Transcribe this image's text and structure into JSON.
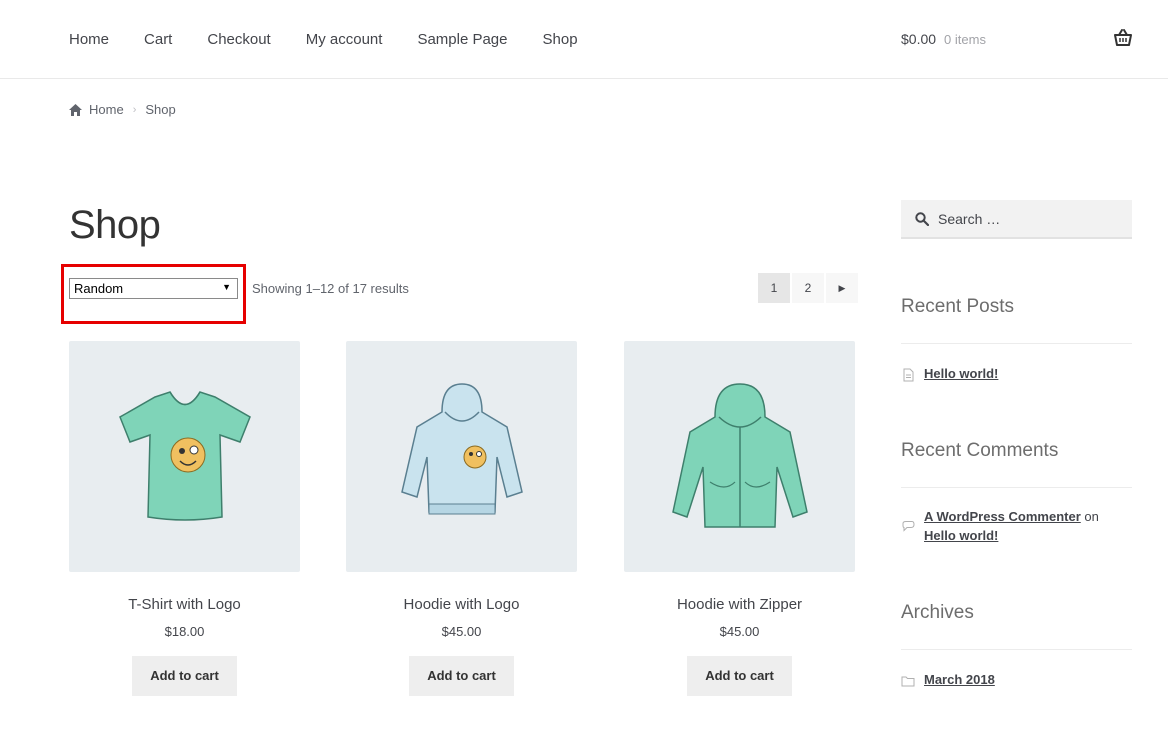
{
  "nav": {
    "items": [
      "Home",
      "Cart",
      "Checkout",
      "My account",
      "Sample Page",
      "Shop"
    ]
  },
  "cart": {
    "amount": "$0.00",
    "count": "0 items",
    "icon": "basket-icon"
  },
  "breadcrumb": {
    "home": "Home",
    "current": "Shop"
  },
  "main": {
    "title": "Shop",
    "sort": {
      "selected": "Random"
    },
    "result_count": "Showing 1–12 of 17 results",
    "pagination": {
      "pages": [
        "1",
        "2"
      ],
      "current": "1"
    }
  },
  "products": [
    {
      "title": "T-Shirt with Logo",
      "price": "$18.00",
      "button": "Add to cart",
      "image": "tshirt-image"
    },
    {
      "title": "Hoodie with Logo",
      "price": "$45.00",
      "button": "Add to cart",
      "image": "hoodie-image"
    },
    {
      "title": "Hoodie with Zipper",
      "price": "$45.00",
      "button": "Add to cart",
      "image": "zip-hoodie-image"
    }
  ],
  "sidebar": {
    "search_placeholder": "Search …",
    "recent_posts": {
      "title": "Recent Posts",
      "items": [
        "Hello world!"
      ]
    },
    "recent_comments": {
      "title": "Recent Comments",
      "author": "A WordPress Commenter",
      "on": "on",
      "post": "Hello world!"
    },
    "archives": {
      "title": "Archives",
      "items": [
        "March 2018"
      ]
    }
  },
  "colors": {
    "highlight": "#e60000",
    "product_bg": "#e8edf0",
    "garment": "#7fd4b8"
  }
}
